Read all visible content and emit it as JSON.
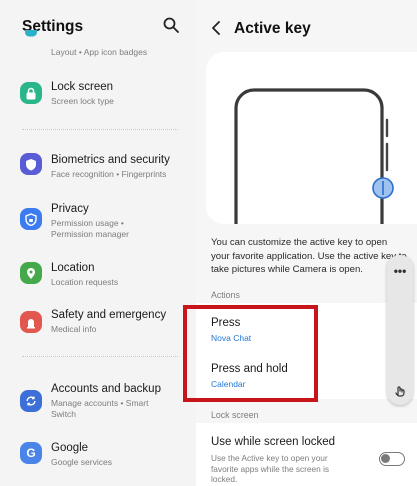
{
  "left_panel": {
    "title": "Settings",
    "partial_item": {
      "sub": "Layout • App icon badges"
    },
    "items": [
      {
        "title": "Lock screen",
        "sub": "Screen lock type",
        "icon": "lock-icon",
        "color": "#2bb58b"
      },
      {
        "title": "Biometrics and security",
        "sub": "Face recognition • Fingerprints",
        "icon": "shield-icon",
        "color": "#5a5cd6"
      },
      {
        "title": "Privacy",
        "sub": "Permission usage •\nPermission manager",
        "icon": "privacy-shield-icon",
        "color": "#3c7cf0"
      },
      {
        "title": "Location",
        "sub": "Location requests",
        "icon": "location-pin-icon",
        "color": "#45a84a"
      },
      {
        "title": "Safety and emergency",
        "sub": "Medical info",
        "icon": "emergency-icon",
        "color": "#e2574e"
      },
      {
        "title": "Accounts and backup",
        "sub": "Manage accounts • Smart\nSwitch",
        "icon": "sync-icon",
        "color": "#3c6fd8"
      },
      {
        "title": "Google",
        "sub": "Google services",
        "icon": "google-icon",
        "color": "#4a84e8"
      }
    ]
  },
  "right_panel": {
    "title": "Active key",
    "description": "You can customize the active key to open your favorite application. Use the active key to take pictures while Camera is open.",
    "actions_label": "Actions",
    "press": {
      "title": "Press",
      "value": "Nova Chat"
    },
    "press_hold": {
      "title": "Press and hold",
      "value": "Calendar"
    },
    "lock_label": "Lock screen",
    "lock_option": {
      "title": "Use while screen locked",
      "sub": "Use the Active key to open your favorite apps while the screen is locked.",
      "enabled": false
    }
  },
  "floating_panel": {
    "menu": "•••",
    "icon": "hand-icon"
  },
  "colors": {
    "accent": "#2378d9",
    "highlight": "#c8151c"
  }
}
